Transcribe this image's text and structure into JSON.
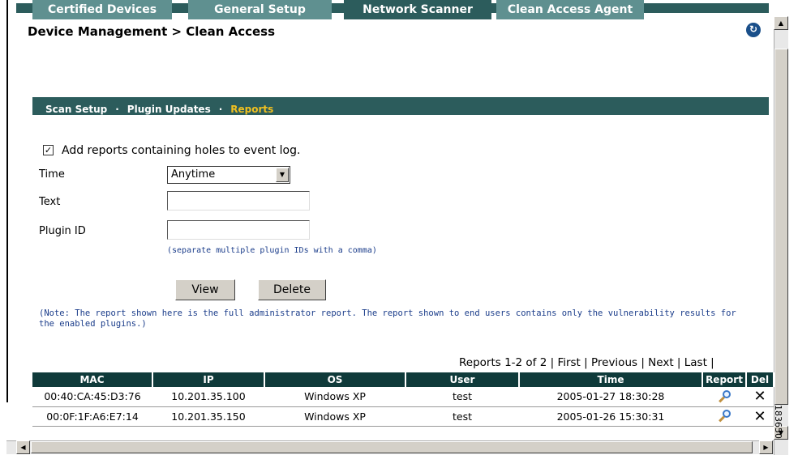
{
  "header": {
    "title": "Device Management > Clean Access",
    "refresh_icon": "refresh-icon"
  },
  "tabs": [
    {
      "label": "Certified Devices",
      "active": false
    },
    {
      "label": "General Setup",
      "active": false
    },
    {
      "label": "Network Scanner",
      "active": true
    },
    {
      "label": "Clean Access Agent",
      "active": false
    }
  ],
  "subtabs": [
    {
      "label": "Scan Setup",
      "active": false
    },
    {
      "label": "Plugin Updates",
      "active": false
    },
    {
      "label": "Reports",
      "active": true
    }
  ],
  "subtab_separator": "·",
  "form": {
    "checkbox_label": "Add reports containing holes to event log.",
    "checkbox_checked": true,
    "time_label": "Time",
    "time_value": "Anytime",
    "text_label": "Text",
    "text_value": "",
    "plugin_label": "Plugin ID",
    "plugin_value": "",
    "plugin_hint": "(separate multiple plugin IDs with a comma)",
    "view_button": "View",
    "delete_button": "Delete"
  },
  "note": "(Note: The report shown here is the full administrator report. The report shown to end users contains only the vulnerability results for the enabled plugins.)",
  "pager": "Reports 1-2 of 2 | First | Previous | Next | Last |",
  "table": {
    "columns": [
      "MAC",
      "IP",
      "OS",
      "User",
      "Time",
      "Report",
      "Del"
    ],
    "rows": [
      {
        "mac": "00:40:CA:45:D3:76",
        "ip": "10.201.35.100",
        "os": "Windows XP",
        "user": "test",
        "time": "2005-01-27 18:30:28"
      },
      {
        "mac": "00:0F:1F:A6:E7:14",
        "ip": "10.201.35.150",
        "os": "Windows XP",
        "user": "test",
        "time": "2005-01-26 15:30:31"
      }
    ]
  },
  "figure_id": "183650",
  "colors": {
    "tab": "#5f9090",
    "tab_active": "#2c5c5c",
    "subtab_active": "#f0c020",
    "header_row": "#0f3a3a",
    "note_text": "#1a3c8a"
  }
}
